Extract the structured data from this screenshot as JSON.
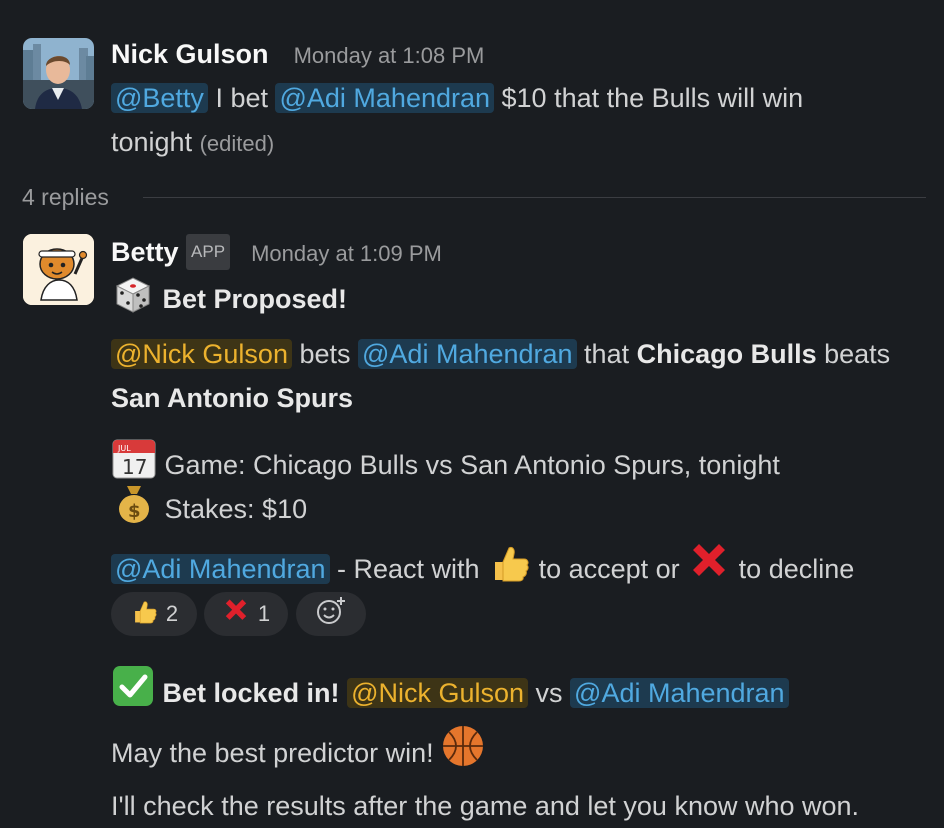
{
  "message1": {
    "author": "Nick Gulson",
    "time": "Monday at 1:08 PM",
    "mention_betty": "@Betty",
    "text_a": " I bet ",
    "mention_adi": "@Adi Mahendran",
    "text_b": " $10 that the Bulls will win",
    "text_c": "tonight",
    "edited": "(edited)"
  },
  "thread": {
    "replies": "4 replies"
  },
  "message2": {
    "author": "Betty",
    "badge": "APP",
    "time": "Monday at 1:09 PM",
    "heading": "Bet Proposed!",
    "mention_nick": "@Nick Gulson",
    "bets": " bets ",
    "mention_adi": "@Adi Mahendran",
    "that": " that ",
    "team1": "Chicago Bulls",
    "beats": " beats",
    "team2": "San Antonio Spurs",
    "game": "Game: Chicago Bulls vs San Antonio Spurs, tonight",
    "stakes": "Stakes: $10",
    "mention_adi2": "@Adi Mahendran",
    "react_a": " - React with ",
    "react_b": " to accept or ",
    "react_c": " to decline",
    "reactions": [
      {
        "icon": "thumbs-up-icon",
        "count": "2"
      },
      {
        "icon": "red-x-icon",
        "count": "1"
      }
    ],
    "locked": "Bet locked in!",
    "mention_nick2": "@Nick Gulson",
    "vs": " vs ",
    "mention_adi3": "@Adi Mahendran",
    "luck": "May the best predictor win! ",
    "check": "I'll check the results after the game and let you know who won."
  },
  "colors": {
    "background": "#1a1d21",
    "mention_blue": "#50a9e0",
    "mention_gold": "#ecb22e"
  }
}
